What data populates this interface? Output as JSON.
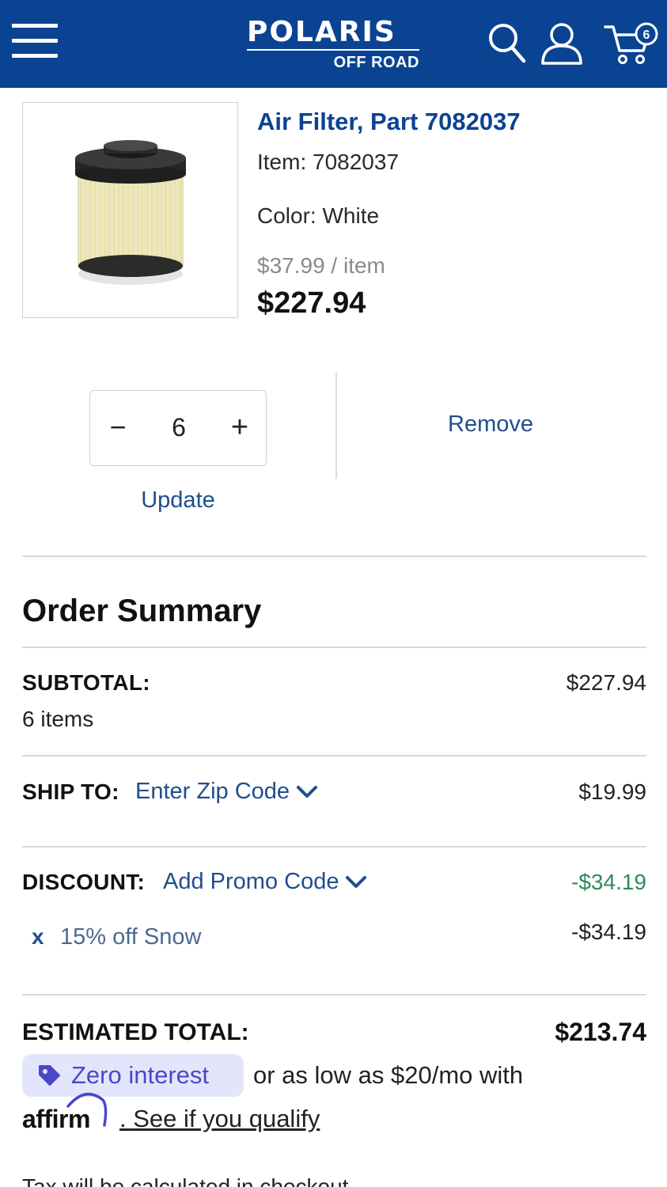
{
  "header": {
    "brand_main": "POLARIS",
    "brand_sub": "OFF ROAD",
    "cart_count": "6",
    "bg_color": "#0b4393"
  },
  "product": {
    "title": "Air Filter,  Part 7082037",
    "item": "Item: 7082037",
    "color": "Color: White",
    "unit_price": "$37.99 / item",
    "line_total": "$227.94",
    "quantity": "6",
    "minus_label": "−",
    "plus_label": "+",
    "update_label": "Update",
    "remove_label": "Remove"
  },
  "summary": {
    "title": "Order Summary",
    "subtotal_label": "SUBTOTAL:",
    "subtotal_items": "6 items",
    "subtotal_amount": "$227.94",
    "ship_label": "SHIP TO:",
    "ship_link": "Enter Zip Code",
    "ship_amount": "$19.99",
    "discount_label": "DISCOUNT:",
    "discount_link": "Add Promo Code",
    "discount_amount": "-$34.19",
    "promo_remove": "x",
    "promo_name": "15% off Snow",
    "promo_amount": "-$34.19",
    "estimated_label": "ESTIMATED TOTAL:",
    "estimated_amount": "$213.74"
  },
  "financing": {
    "badge_text": "Zero interest",
    "rest_text": "or as low as $20/mo with",
    "affirm_brand": "affirm",
    "qualify_link": "See if you qualify",
    "cut_off_text": "Tax will be calculated in checkout"
  }
}
